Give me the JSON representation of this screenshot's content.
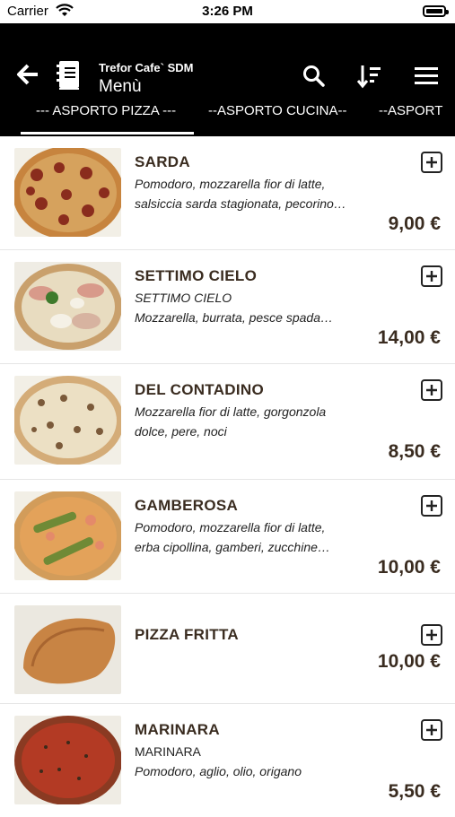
{
  "status": {
    "carrier": "Carrier",
    "time": "3:26 PM"
  },
  "header": {
    "app_name": "Trefor Cafe` SDM",
    "subtitle": "Menù",
    "tabs": [
      "--- ASPORTO PIZZA ---",
      "--ASPORTO CUCINA--",
      "--ASPORT"
    ]
  },
  "items": [
    {
      "name": "SARDA",
      "line1": "Pomodoro, mozzarella fior di latte,",
      "line2": "salsiccia sarda stagionata, pecorino…",
      "price": "9,00 €"
    },
    {
      "name": "SETTIMO CIELO",
      "line1": "SETTIMO CIELO",
      "line2": "Mozzarella, burrata, pesce spada…",
      "price": "14,00 €"
    },
    {
      "name": "DEL CONTADINO",
      "line1": "Mozzarella fior di latte, gorgonzola",
      "line2": "dolce, pere, noci",
      "price": "8,50 €"
    },
    {
      "name": "GAMBEROSA",
      "line1": "Pomodoro, mozzarella fior di latte,",
      "line2": "erba cipollina, gamberi, zucchine…",
      "price": "10,00 €"
    },
    {
      "name": "PIZZA FRITTA",
      "line1": "",
      "line2": "",
      "price": "10,00 €"
    },
    {
      "name": "MARINARA",
      "line1": "MARINARA",
      "line2": "Pomodoro, aglio, olio, origano",
      "price": "5,50 €"
    }
  ]
}
